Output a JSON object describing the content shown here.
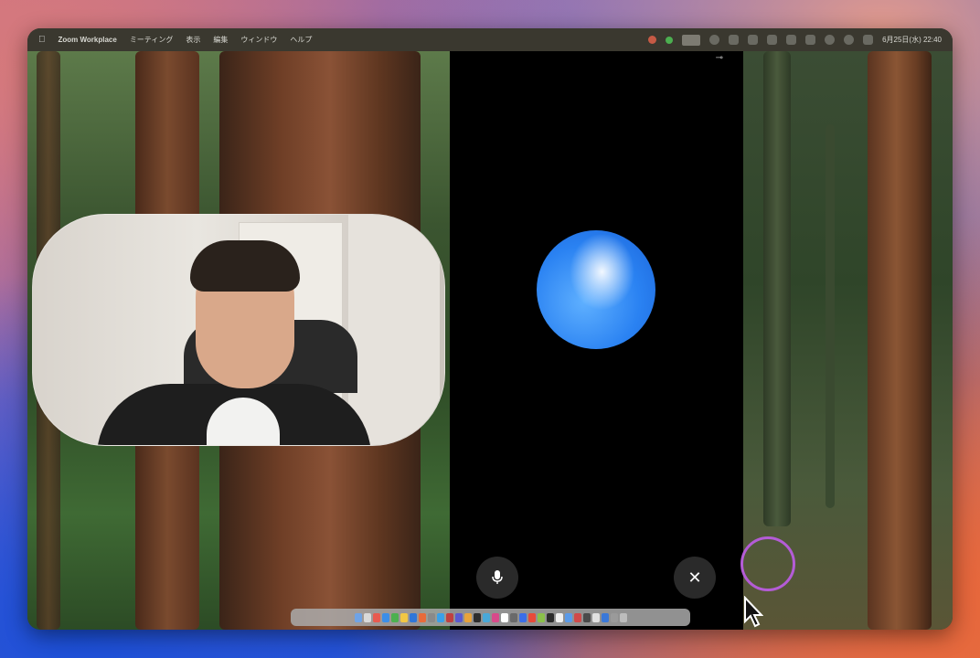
{
  "menubar": {
    "apple_icon": "apple-icon",
    "app_name": "Zoom Workplace",
    "menus": [
      "ミーティング",
      "表示",
      "編集",
      "ウィンドウ",
      "ヘルプ"
    ],
    "clock": "6月25日(水) 22:40"
  },
  "assistant": {
    "orb_colors": [
      "#f2f8ff",
      "#5fb0ff",
      "#1b63d8"
    ],
    "mic_icon": "microphone-icon",
    "close_icon": "close-icon",
    "close_glyph": "✕"
  },
  "dock": {
    "icon_colors": [
      "#6fa3e6",
      "#d9d9d9",
      "#e85a4f",
      "#3c8ee8",
      "#4cb050",
      "#f2c744",
      "#2f76d8",
      "#e76b3a",
      "#8a8a8a",
      "#3aa0e8",
      "#c04040",
      "#5a5ad0",
      "#e8a33a",
      "#2e2e2e",
      "#4aa8d8",
      "#d84a8a",
      "#ffffff",
      "#6a6a6a",
      "#3b6ee8",
      "#e84a3a",
      "#8ac04a",
      "#2b2b2b",
      "#f0f0f0",
      "#5a9ae8",
      "#d04a4a",
      "#4a4a4a",
      "#e0e0e0",
      "#3a78d8",
      "#9a9a9a",
      "#bcbcbc"
    ]
  },
  "colors": {
    "highlight_ring": "#b45cd6"
  }
}
